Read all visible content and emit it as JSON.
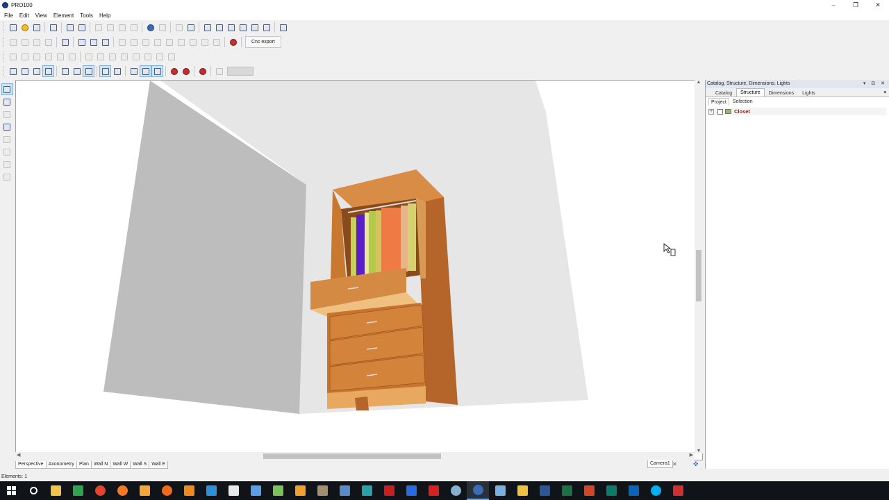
{
  "window": {
    "title": "PRO100",
    "controls": [
      "–",
      "❐",
      "✕"
    ]
  },
  "menu": [
    "File",
    "Edit",
    "View",
    "Element",
    "Tools",
    "Help"
  ],
  "toolbar": {
    "cnc_export_label": "Cnc export"
  },
  "view_tabs": [
    "Perspective",
    "Axonometry",
    "Plan",
    "Wall N",
    "Wall W",
    "Wall S",
    "Wall E"
  ],
  "camera_tab": {
    "label": "Camera1",
    "close": "✕",
    "add": "✜"
  },
  "right_panel": {
    "header": "Catalog, Structure, Dimensions, Lights",
    "header_buttons": "▾ ⊟ ✕",
    "tabs": [
      "Catalog",
      "Structure",
      "Dimensions",
      "Lights"
    ],
    "active_tab": "Structure",
    "subtabs": [
      "Project",
      "Selection"
    ],
    "tree": [
      {
        "label": "Closet",
        "expand": "+"
      }
    ]
  },
  "status": {
    "text": "Elements: 1"
  },
  "colors": {
    "wood": "#d3833a",
    "wood_dark": "#a85a22",
    "wall": "#bdbdbd",
    "floor": "#e6e6e6",
    "taskbar": "#101418"
  },
  "taskbar_icons": [
    "windows-start",
    "search",
    "file-explorer",
    "google-drive",
    "chrome",
    "firefox",
    "blender",
    "origin",
    "vlc",
    "visual-studio-code",
    "calculator",
    "notepad",
    "notepad-plus",
    "bookmarks",
    "gimp",
    "paint-net",
    "arduino",
    "filezilla",
    "malwarebytes",
    "acrobat",
    "steam",
    "pro100",
    "network",
    "folder",
    "word",
    "excel",
    "powerpoint",
    "publisher",
    "outlook",
    "skype",
    "snipping-tool"
  ]
}
